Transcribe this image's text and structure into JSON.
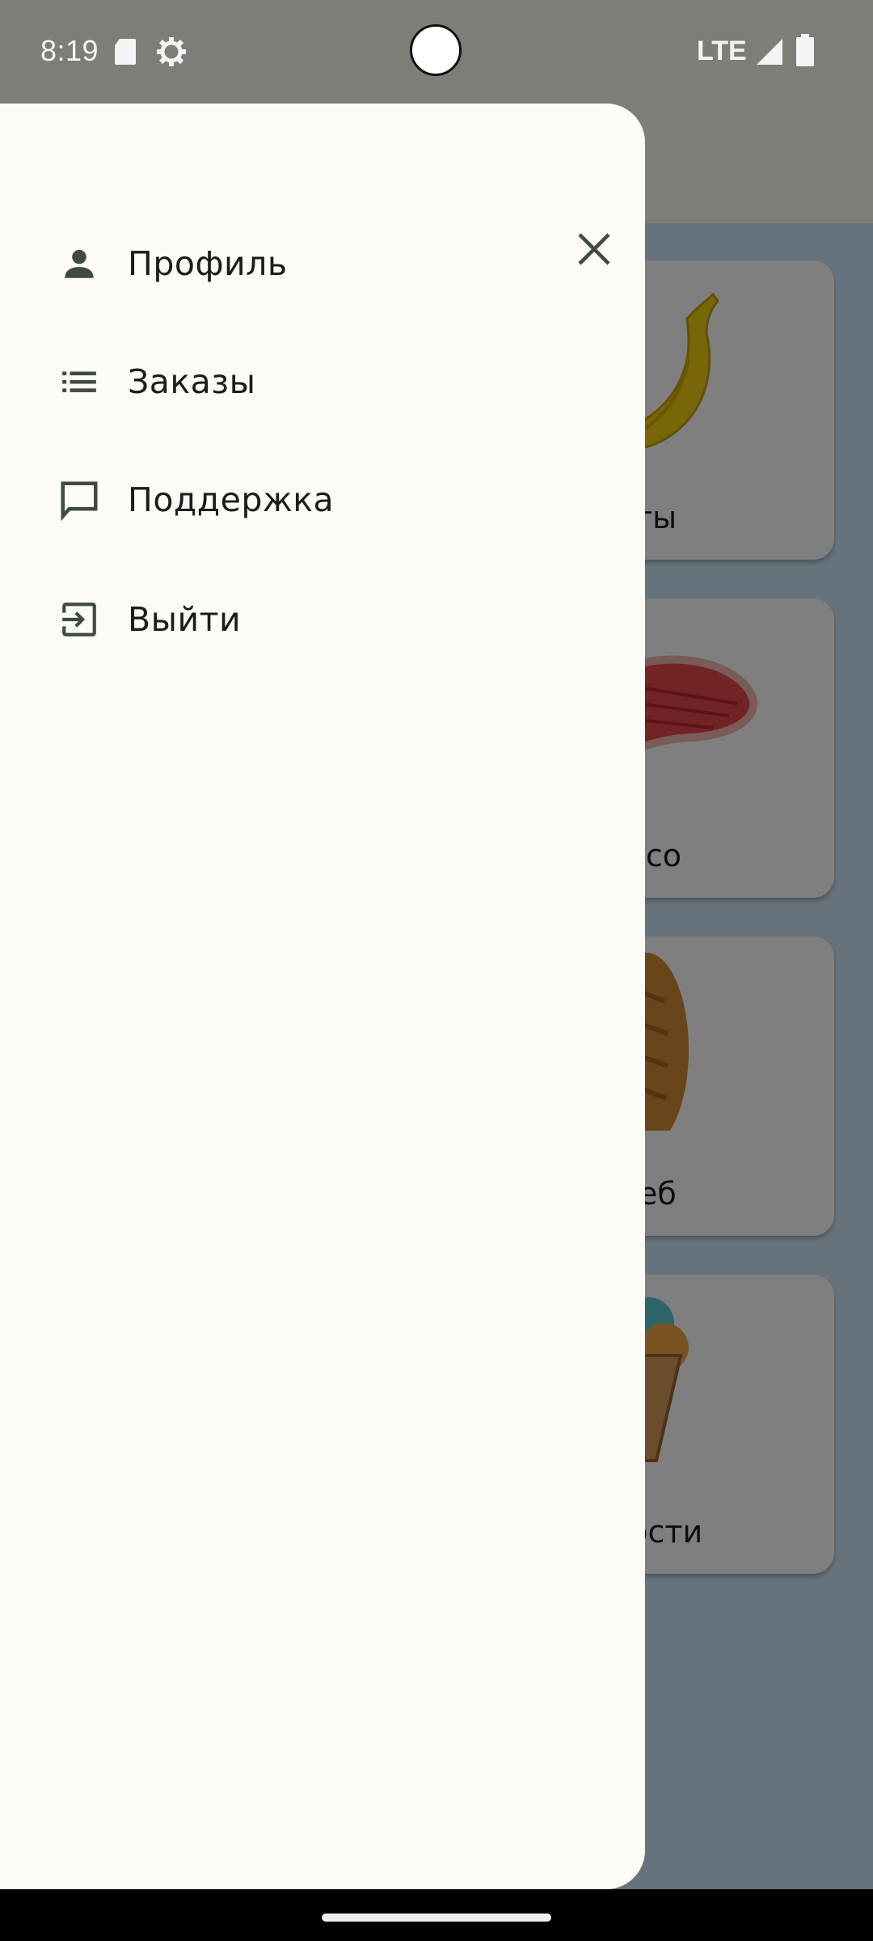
{
  "status_bar": {
    "time": "8:19",
    "network": "LTE",
    "icons": [
      "sd-card-icon",
      "settings-gear-icon",
      "signal-icon",
      "battery-icon"
    ]
  },
  "background_app": {
    "categories": [
      {
        "label": "Фрукты",
        "visible_label": "кты",
        "icon": "banana-icon"
      },
      {
        "label": "Мясо",
        "visible_label": "ясо",
        "icon": "steak-icon"
      },
      {
        "label": "Хлеб",
        "visible_label": "еб",
        "icon": "bread-icon"
      },
      {
        "label": "Сладости",
        "visible_label": "дости",
        "icon": "ice-cream-icon"
      }
    ]
  },
  "drawer": {
    "close_icon": "close-icon",
    "items": [
      {
        "label": "Профиль",
        "icon": "person-icon"
      },
      {
        "label": "Заказы",
        "icon": "list-icon"
      },
      {
        "label": "Поддержка",
        "icon": "chat-icon"
      },
      {
        "label": "Выйти",
        "icon": "logout-icon"
      }
    ]
  },
  "colors": {
    "drawer_bg": "#fbfcf5",
    "icon": "#3f4a42",
    "app_bg": "#cfe6f9",
    "scrim": "rgba(0,0,0,0.5)"
  }
}
